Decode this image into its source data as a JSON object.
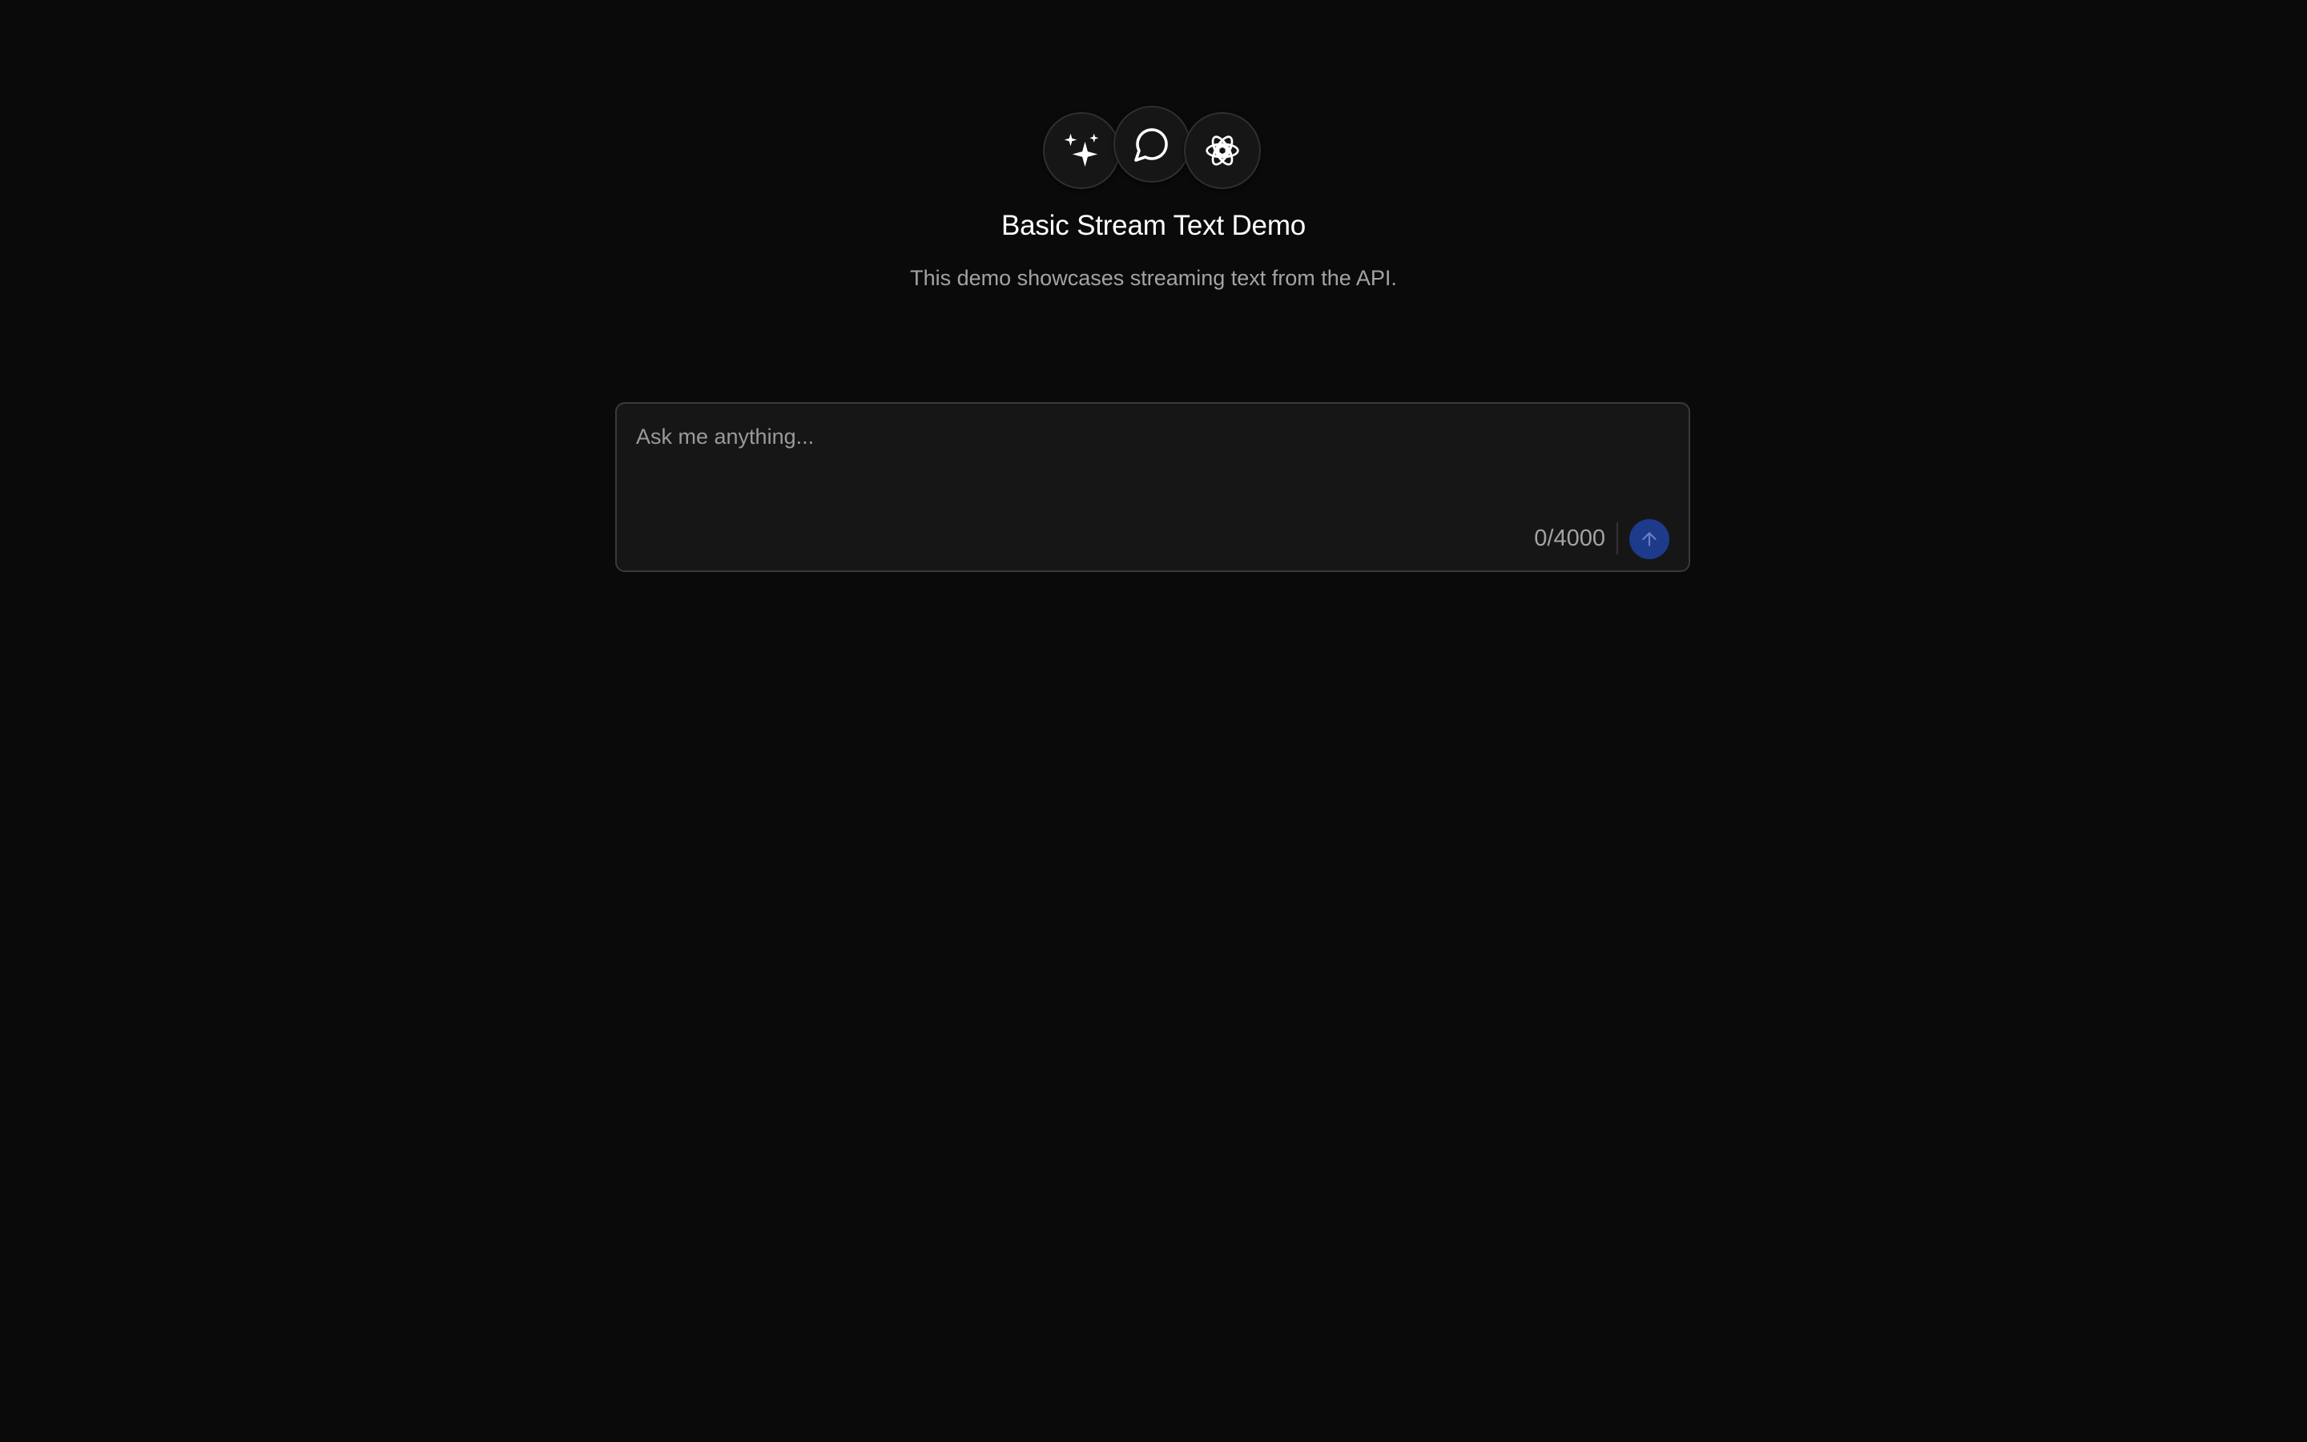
{
  "header": {
    "icons": [
      "sparkles-icon",
      "message-circle-icon",
      "openai-logo-icon"
    ],
    "title": "Basic Stream Text Demo",
    "subtitle": "This demo showcases streaming text from the API."
  },
  "composer": {
    "placeholder": "Ask me anything...",
    "value": "",
    "counter": "0/4000",
    "send_icon": "arrow-up-icon"
  },
  "colors": {
    "background": "#0a0a0a",
    "surface": "#161616",
    "border": "#3a3a3a",
    "accent": "#1e3a8a"
  }
}
